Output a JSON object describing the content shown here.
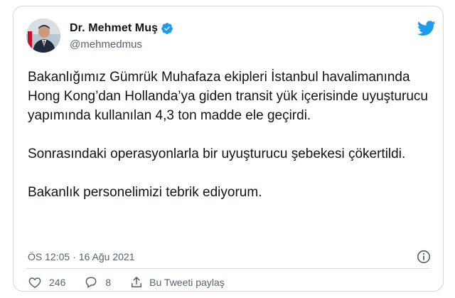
{
  "tweet": {
    "author_name": "Dr. Mehmet Muş",
    "handle": "@mehmedmus",
    "paragraphs": [
      "Bakanlığımız Gümrük Muhafaza ekipleri İstanbul havalimanında Hong Kong’dan Hollanda’ya giden transit yük içerisinde uyuşturucu yapımında kullanılan 4,3 ton madde ele geçirdi.",
      "Sonrasındaki operasyonlarla bir uyuşturucu şebekesi çökertildi.",
      "Bakanlık personelimizi tebrik ediyorum."
    ],
    "time": "ÖS 12:05",
    "separator": "·",
    "date": "16 Ağu 2021"
  },
  "actions": {
    "like_count": "246",
    "reply_count": "8",
    "share_label": "Bu Tweeti paylaş"
  },
  "icons": {
    "verified": "verified-badge-icon",
    "bird": "twitter-bird-icon",
    "info": "info-icon",
    "like": "heart-icon",
    "reply": "reply-icon",
    "share": "share-icon"
  },
  "colors": {
    "brand_blue": "#1d9bf0",
    "text": "#0f1419",
    "muted": "#536471",
    "border": "#cfd9de"
  }
}
